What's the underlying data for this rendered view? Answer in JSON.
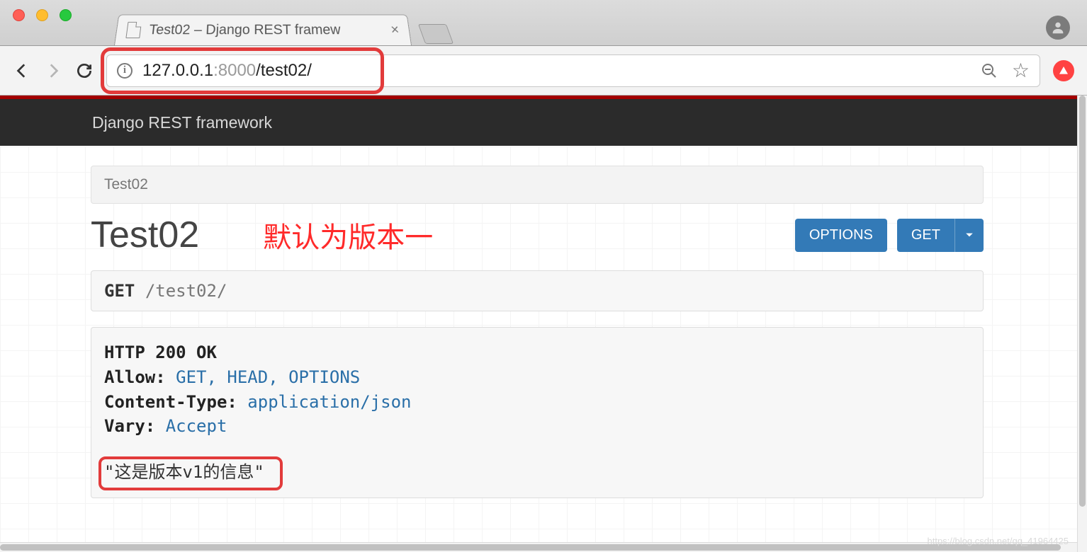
{
  "browser": {
    "tab_title": "Test02 – Django REST framew",
    "url_host": "127.0.0.1",
    "url_port": ":8000",
    "url_path": "/test02/"
  },
  "header": {
    "brand": "Django REST framework"
  },
  "breadcrumb": {
    "label": "Test02"
  },
  "page": {
    "title": "Test02",
    "annotation": "默认为版本一"
  },
  "buttons": {
    "options": "OPTIONS",
    "get": "GET"
  },
  "request": {
    "method": "GET",
    "path": "/test02/"
  },
  "response": {
    "status_line": "HTTP 200 OK",
    "headers": [
      {
        "key": "Allow:",
        "value": "GET, HEAD, OPTIONS"
      },
      {
        "key": "Content-Type:",
        "value": "application/json"
      },
      {
        "key": "Vary:",
        "value": "Accept"
      }
    ],
    "body": "\"这是版本v1的信息\""
  },
  "watermark": "https://blog.csdn.net/qq_41964425"
}
